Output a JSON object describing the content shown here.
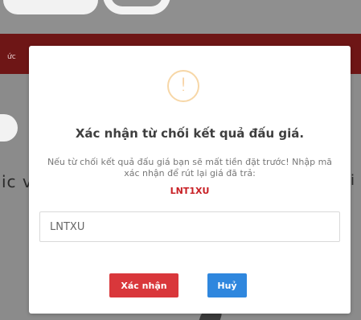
{
  "background": {
    "redbar_text": "ức",
    "left_text": "ic v",
    "right_text": "i"
  },
  "modal": {
    "icon": "warning-icon",
    "icon_glyph": "!",
    "title": "Xác nhận từ chối kết quả đấu giá.",
    "description": "Nếu từ chối kết quả đấu giá bạn sẽ mất tiền đặt trước! Nhập mã xác nhận để rút lại giá đã trả:",
    "code": "LNT1XU",
    "input_value": "LNTXU",
    "confirm_label": "Xác nhận",
    "cancel_label": "Huỷ"
  },
  "colors": {
    "confirm": "#d9373b",
    "cancel": "#2f87de",
    "code": "#c81f24",
    "warning": "#f3b262",
    "header": "#6e1616"
  }
}
